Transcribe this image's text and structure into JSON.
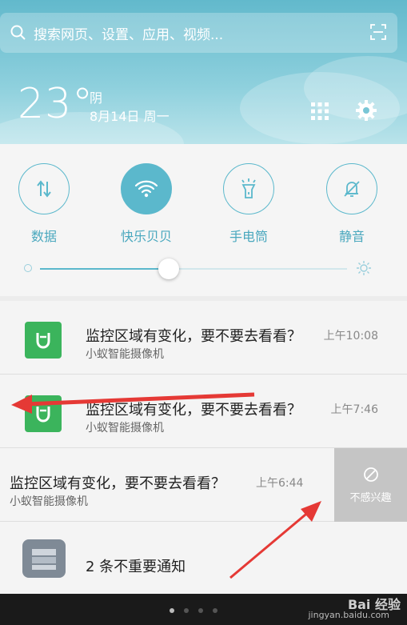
{
  "search": {
    "placeholder": "搜索网页、设置、应用、视频..."
  },
  "weather": {
    "temperature": "23°",
    "condition": "阴",
    "date": "8月14日 周一"
  },
  "quick_settings": {
    "tiles": [
      {
        "label": "数据",
        "icon": "data-arrows-icon",
        "active": false
      },
      {
        "label": "快乐贝贝",
        "icon": "wifi-icon",
        "active": true
      },
      {
        "label": "手电筒",
        "icon": "flashlight-icon",
        "active": false
      },
      {
        "label": "静音",
        "icon": "bell-mute-icon",
        "active": false
      }
    ],
    "brightness_level": 0.42
  },
  "notifications": [
    {
      "title": "监控区域有变化，要不要去看看？",
      "app": "小蚁智能摄像机",
      "time": "上午10:08"
    },
    {
      "title": "监控区域有变化，要不要去看看？",
      "app": "小蚁智能摄像机",
      "time": "上午7:46"
    },
    {
      "title": "监控区域有变化，要不要去看看？",
      "app": "小蚁智能摄像机",
      "time": "上午6:44"
    }
  ],
  "swipe_action": {
    "label": "不感兴趣",
    "icon": "block-icon"
  },
  "unimportant": {
    "label": "2 条不重要通知"
  },
  "watermark": {
    "brand": "Bai 经验",
    "url": "jingyan.baidu.com"
  },
  "colors": {
    "accent": "#5bb8cc",
    "app_green": "#3bb45c",
    "arrow_red": "#e53935"
  }
}
